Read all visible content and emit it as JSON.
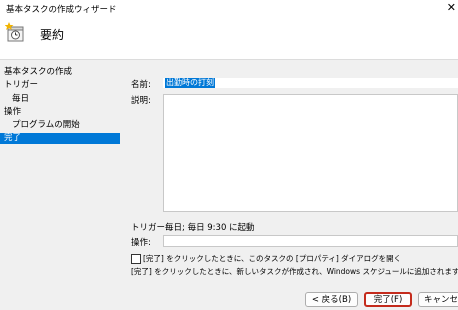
{
  "window": {
    "title": "基本タスクの作成ウィザード",
    "close_glyph": "✕"
  },
  "header": {
    "title": "要約",
    "icon": "task-scheduler-icon"
  },
  "sidebar": {
    "items": [
      {
        "label": "基本タスクの作成"
      },
      {
        "label": "トリガー"
      },
      {
        "label": "毎日"
      },
      {
        "label": "操作"
      },
      {
        "label": "プログラムの開始"
      },
      {
        "label": "完了"
      }
    ]
  },
  "form": {
    "name_label": "名前:",
    "name_value": "出勤時の打刻",
    "description_label": "説明:",
    "trigger_label": "トリガー:",
    "trigger_value": "毎日; 毎日 9:30 に起動",
    "action_label": "操作:",
    "action_value": ""
  },
  "checkbox": {
    "label": "[完了] をクリックしたときに、このタスクの [プロパティ] ダイアログを開く",
    "checked": false
  },
  "note": "[完了] をクリックしたときに、新しいタスクが作成され、Windows スケジュールに追加されます。",
  "buttons": {
    "back": "< 戻る(B)",
    "finish": "完了(F)",
    "cancel": "キャンセル"
  },
  "colors": {
    "selection": "#0078d7",
    "finish_border": "#c42b1c"
  }
}
